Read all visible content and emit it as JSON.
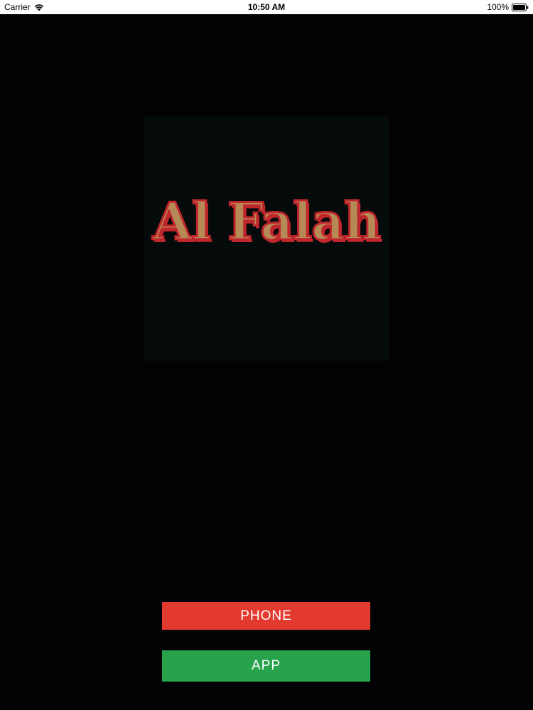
{
  "status_bar": {
    "carrier": "Carrier",
    "time": "10:50 AM",
    "battery": "100%",
    "wifi_icon": "wifi-icon",
    "battery_icon": "battery-icon"
  },
  "logo": {
    "text": "Al Falah",
    "fill_color": "#b68a57",
    "outline_color": "#c0262b"
  },
  "buttons": {
    "phone_label": "PHONE",
    "phone_color": "#e23a2f",
    "app_label": "APP",
    "app_color": "#28a34c"
  },
  "colors": {
    "background": "#020204",
    "status_bar": "#ffffff"
  }
}
